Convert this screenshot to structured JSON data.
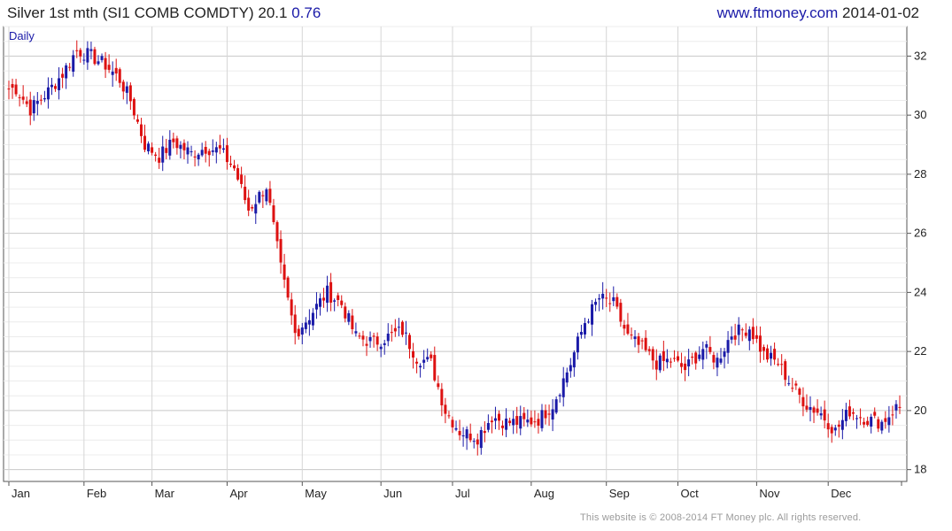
{
  "header": {
    "title": "Silver 1st mth (SI1 COMB COMDTY)",
    "last": "20.1",
    "change": "0.76",
    "site": "www.ftmoney.com",
    "date": "2014-01-02"
  },
  "footer": "This website is © 2008-2014 FT Money plc. All rights reserved.",
  "colors": {
    "up": "#1a1aa8",
    "down": "#dd1111",
    "grid": "#cccccc",
    "axis": "#555555"
  },
  "chart_data": {
    "type": "candlestick",
    "period_label": "Daily",
    "x_tick_labels": [
      "Jan",
      "Feb",
      "Mar",
      "Apr",
      "May",
      "Jun",
      "Jul",
      "Aug",
      "Sep",
      "Oct",
      "Nov",
      "Dec"
    ],
    "y_ticks": [
      18,
      20,
      22,
      24,
      26,
      28,
      30,
      32
    ],
    "ylim": [
      17.6,
      33.0
    ],
    "grid": true,
    "y_axis_side": "right",
    "approx_close_by_week": [
      {
        "month": "Jan",
        "closes": [
          30.9,
          30.2,
          30.8,
          31.4,
          32.2
        ]
      },
      {
        "month": "Feb",
        "closes": [
          32.0,
          31.7,
          31.2,
          30.5,
          29.0
        ]
      },
      {
        "month": "Mar",
        "closes": [
          28.6,
          29.1,
          28.7,
          28.9,
          28.8
        ]
      },
      {
        "month": "Apr",
        "closes": [
          28.2,
          26.8,
          27.6,
          24.8,
          22.6
        ]
      },
      {
        "month": "May",
        "closes": [
          23.2,
          24.0,
          23.6,
          22.5,
          22.3
        ]
      },
      {
        "month": "Jun",
        "closes": [
          22.5,
          22.7,
          21.8,
          21.6,
          20.0
        ]
      },
      {
        "month": "Jul",
        "closes": [
          19.3,
          19.1,
          19.8,
          19.6,
          19.6
        ]
      },
      {
        "month": "Aug",
        "closes": [
          19.7,
          20.2,
          21.6,
          23.0,
          23.8
        ]
      },
      {
        "month": "Sep",
        "closes": [
          23.6,
          22.5,
          22.1,
          21.6,
          21.7
        ]
      },
      {
        "month": "Oct",
        "closes": [
          21.4,
          22.1,
          21.7,
          22.6,
          22.8
        ]
      },
      {
        "month": "Nov",
        "closes": [
          21.9,
          21.6,
          20.8,
          20.2,
          19.9
        ]
      },
      {
        "month": "Dec",
        "closes": [
          19.3,
          20.0,
          19.7,
          19.6,
          20.1
        ]
      }
    ]
  }
}
